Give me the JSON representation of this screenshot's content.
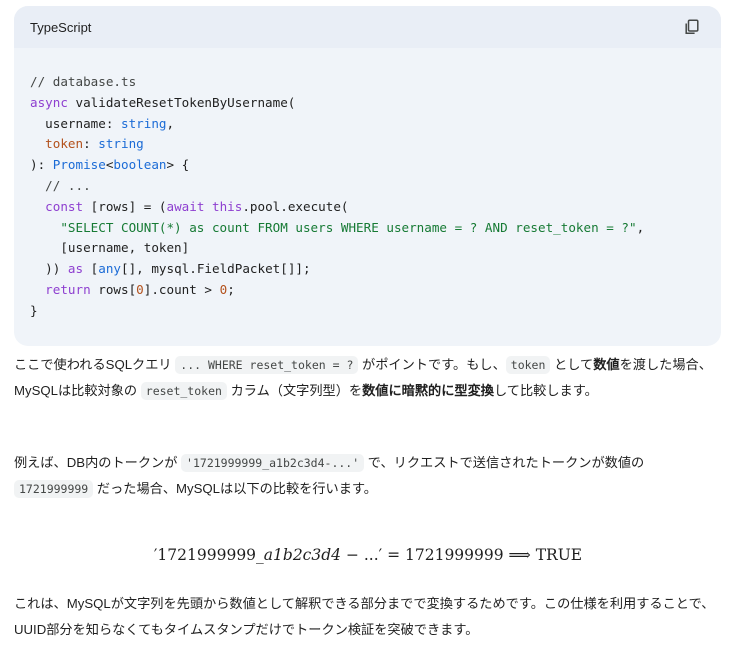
{
  "code_block": {
    "language": "TypeScript",
    "copy_icon": "copy-icon",
    "lines": {
      "l1": "// database.ts",
      "l2_kw": "async",
      "l2_rest": " validateResetTokenByUsername(",
      "l3_a": "  username: ",
      "l3_type": "string",
      "l3_b": ",",
      "l4_prop": "  token",
      "l4_a": ": ",
      "l4_type": "string",
      "l5_a": "): ",
      "l5_type1": "Promise",
      "l5_b": "<",
      "l5_type2": "boolean",
      "l5_c": "> {",
      "l6": "  // ...",
      "l7_kw1": "  const",
      "l7_a": " [rows] = (",
      "l7_kw2": "await",
      "l7_b": " ",
      "l7_kw3": "this",
      "l7_c": ".pool.execute(",
      "l8_str": "    \"SELECT COUNT(*) as count FROM users WHERE username = ? AND reset_token = ?\"",
      "l8_b": ",",
      "l9": "    [username, token]",
      "l10_a": "  )) ",
      "l10_kw": "as",
      "l10_b": " [",
      "l10_type": "any",
      "l10_c": "[], mysql.FieldPacket[]];",
      "l11_kw": "  return",
      "l11_a": " rows[",
      "l11_n1": "0",
      "l11_b": "].count > ",
      "l11_n2": "0",
      "l11_c": ";",
      "l12": "}"
    }
  },
  "para1": {
    "t1": "ここで使われるSQLクエリ ",
    "c1": "... WHERE reset_token = ?",
    "t2": " がポイントです。もし、",
    "c2": "token",
    "t3": " として",
    "b1": "数値",
    "t4": "を渡した場合、MySQLは比較対象の ",
    "c3": "reset_token",
    "t5": " カラム（文字列型）を",
    "b2": "数値に暗黙的に型変換",
    "t6": "して比較します。"
  },
  "para2": {
    "t1": "例えば、DB内のトークンが ",
    "c1": "'1721999999_a1b2c3d4-...'",
    "t2": " で、リクエストで送信されたトークンが数値の ",
    "c2": "1721999999",
    "t3": " だった場合、MySQLは以下の比較を行います。"
  },
  "math": {
    "lhs_num": "′1721999999_",
    "lhs_var": "a1b2c3d4",
    "lhs_rest": " − ...′ = 1721999999  ⟹  TRUE"
  },
  "para3": {
    "text": "これは、MySQLが文字列を先頭から数値として解釈できる部分までで変換するためです。この仕様を利用することで、UUID部分を知らなくてもタイムスタンプだけでトークン検証を突破できます。"
  }
}
